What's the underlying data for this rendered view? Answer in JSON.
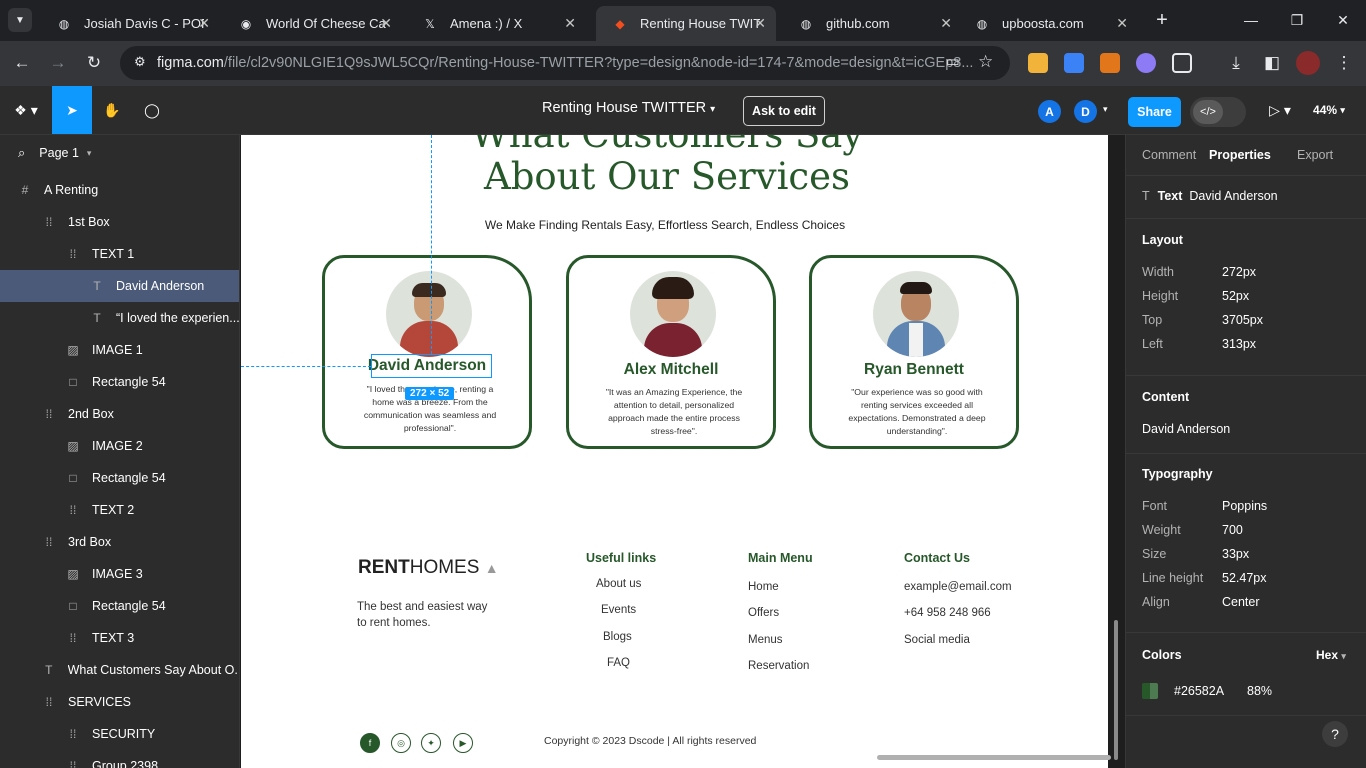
{
  "browser": {
    "tabs": [
      {
        "title": "Josiah Davis C - PORT",
        "icon": "globe-icon"
      },
      {
        "title": "World Of Cheese Cake",
        "icon": "eye-icon"
      },
      {
        "title": "Amena :) / X",
        "icon": "x-logo-icon"
      },
      {
        "title": "Renting House TWITTER",
        "icon": "figma-icon",
        "active": true
      },
      {
        "title": "github.com",
        "icon": "globe-icon"
      },
      {
        "title": "upboosta.com",
        "icon": "globe-icon"
      }
    ],
    "url_domain": "figma.com",
    "url_rest": "/file/cl2v90NLGIE1Q9sJWL5CQr/Renting-House-TWITTER?type=design&node-id=174-7&mode=design&t=icGEp8..."
  },
  "figma": {
    "file_name": "Renting House TWITTER",
    "ask_to_edit": "Ask to edit",
    "avatars": [
      "A",
      "D"
    ],
    "share": "Share",
    "zoom": "44%",
    "page": "Page 1",
    "layers": [
      {
        "name": "A Renting",
        "icon": "#",
        "indent": 0
      },
      {
        "name": "1st Box",
        "icon": "⁞⁞",
        "indent": 1
      },
      {
        "name": "TEXT 1",
        "icon": "⁞⁞",
        "indent": 2
      },
      {
        "name": "David Anderson",
        "icon": "T",
        "indent": 3,
        "selected": true
      },
      {
        "name": "“I loved the experien...",
        "icon": "T",
        "indent": 3
      },
      {
        "name": "IMAGE 1",
        "icon": "▨",
        "indent": 2
      },
      {
        "name": "Rectangle 54",
        "icon": "□",
        "indent": 2
      },
      {
        "name": "2nd Box",
        "icon": "⁞⁞",
        "indent": 1
      },
      {
        "name": "IMAGE 2",
        "icon": "▨",
        "indent": 2
      },
      {
        "name": "Rectangle 54",
        "icon": "□",
        "indent": 2
      },
      {
        "name": "TEXT 2",
        "icon": "⁞⁞",
        "indent": 2
      },
      {
        "name": "3rd Box",
        "icon": "⁞⁞",
        "indent": 1
      },
      {
        "name": "IMAGE 3",
        "icon": "▨",
        "indent": 2
      },
      {
        "name": "Rectangle 54",
        "icon": "□",
        "indent": 2
      },
      {
        "name": "TEXT 3",
        "icon": "⁞⁞",
        "indent": 2
      },
      {
        "name": "What Customers Say About O...",
        "icon": "T",
        "indent": 1
      },
      {
        "name": "SERVICES",
        "icon": "⁞⁞",
        "indent": 1
      },
      {
        "name": "SECURITY",
        "icon": "⁞⁞",
        "indent": 2
      },
      {
        "name": "Group 2398",
        "icon": "⁞⁞",
        "indent": 2
      }
    ]
  },
  "design": {
    "heading_line1": "What Customers Say",
    "heading_line2": "About Our Services",
    "subtitle": "We Make Finding Rentals Easy, Effortless Search, Endless Choices",
    "selection_badge": "272 × 52",
    "cards": [
      {
        "name": "David Anderson",
        "quote": "\"I loved the experience, renting a home was a breeze. From the communication was seamless and professional\".",
        "shirt": "#b5473a"
      },
      {
        "name": "Alex Mitchell",
        "quote": "\"It was an Amazing Experience, the attention to detail, personalized approach made the entire process stress-free\".",
        "shirt": "#7a2230"
      },
      {
        "name": "Ryan Bennett",
        "quote": "\"Our experience was so good with renting services exceeded all expectations. Demonstrated a deep understanding\".",
        "shirt": "#5f86b3"
      }
    ],
    "footer": {
      "logo_bold": "RENT",
      "logo_light": "HOMES",
      "tagline": "The best and easiest way to rent homes.",
      "useful_title": "Useful links",
      "useful": [
        "About us",
        "Events",
        "Blogs",
        "FAQ"
      ],
      "menu_title": "Main Menu",
      "menu": [
        "Home",
        "Offers",
        "Menus",
        "Reservation"
      ],
      "contact_title": "Contact Us",
      "contact": [
        "example@email.com",
        "+64 958 248 966",
        "Social media"
      ],
      "copyright": "Copyright  © 2023 Dscode | All rights reserved"
    }
  },
  "inspector": {
    "tabs": [
      "Comment",
      "Properties",
      "Export"
    ],
    "active_tab": "Properties",
    "type": "Text",
    "layer_name": "David Anderson",
    "layout_title": "Layout",
    "layout": [
      {
        "label": "Width",
        "value": "272px"
      },
      {
        "label": "Height",
        "value": "52px"
      },
      {
        "label": "Top",
        "value": "3705px"
      },
      {
        "label": "Left",
        "value": "313px"
      }
    ],
    "content_title": "Content",
    "content": "David Anderson",
    "typography_title": "Typography",
    "typography": [
      {
        "label": "Font",
        "value": "Poppins"
      },
      {
        "label": "Weight",
        "value": "700"
      },
      {
        "label": "Size",
        "value": "33px"
      },
      {
        "label": "Line height",
        "value": "52.47px"
      },
      {
        "label": "Align",
        "value": "Center"
      }
    ],
    "colors_title": "Colors",
    "color_format": "Hex",
    "color_hex": "#26582A",
    "color_opacity": "88%",
    "help": "?"
  }
}
